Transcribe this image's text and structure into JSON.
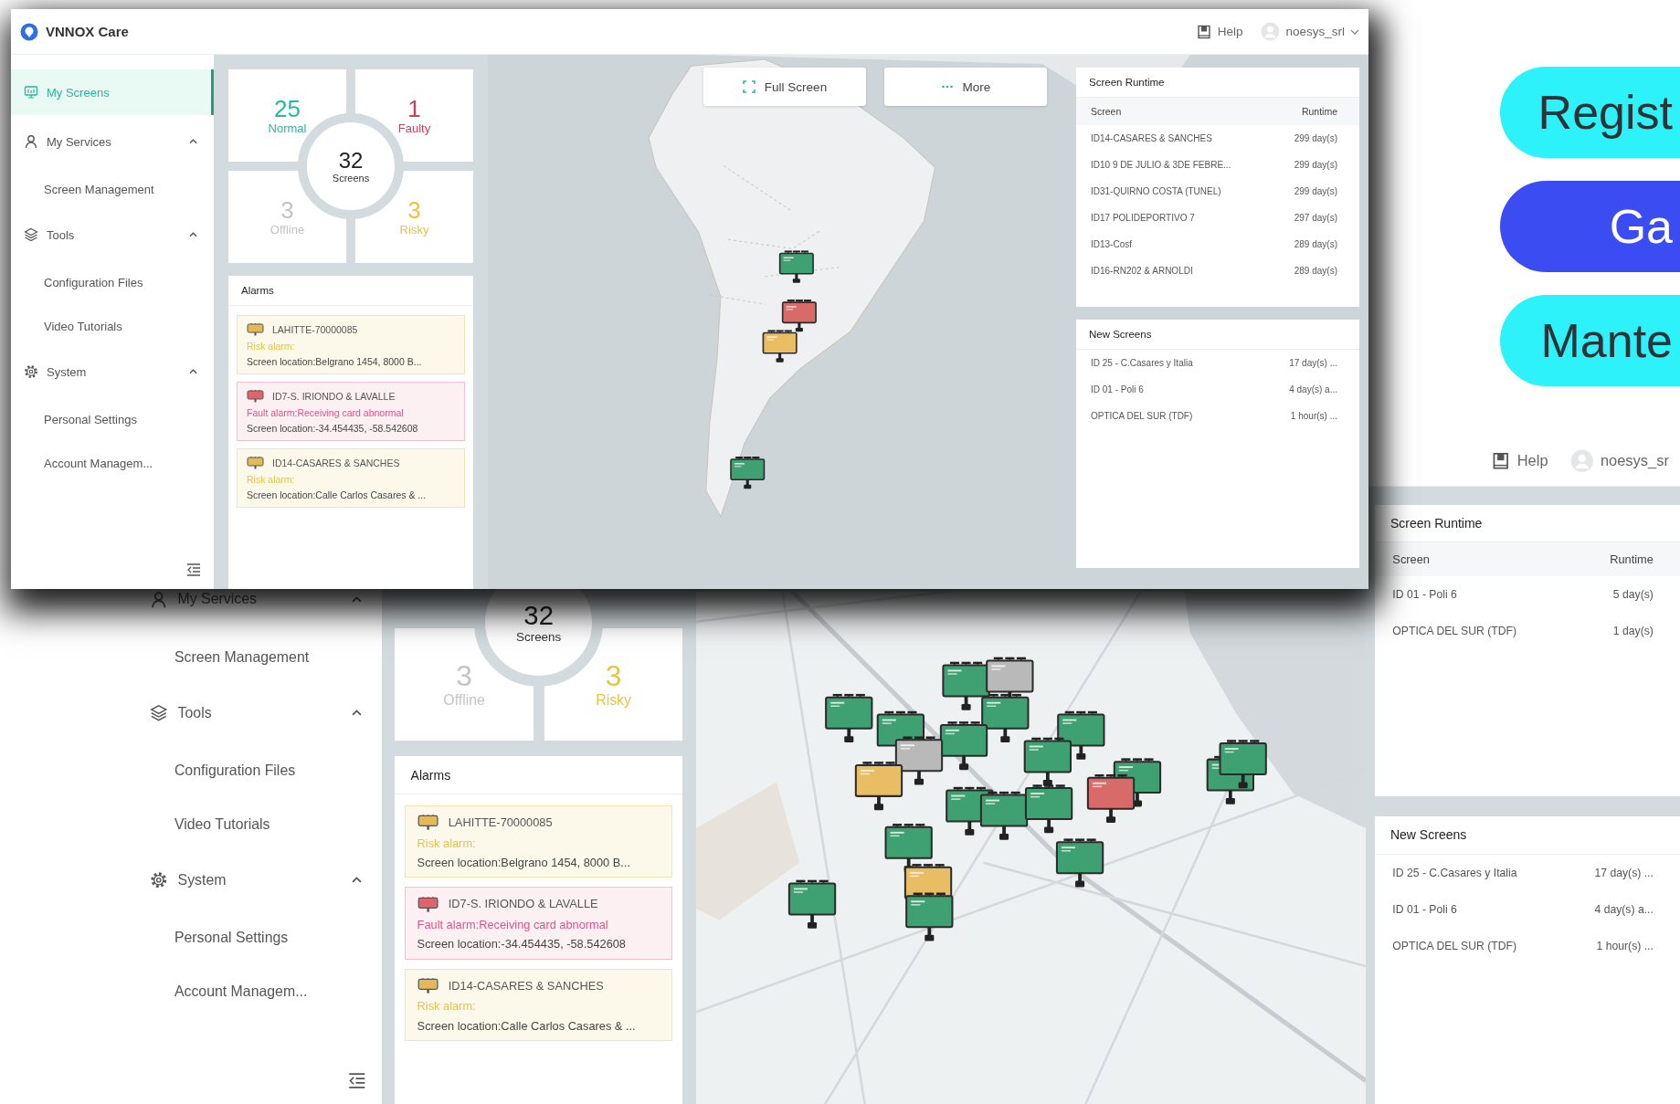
{
  "back_window": {
    "header": {
      "help": "Help",
      "user": "noesys_sr"
    },
    "sidebar": {
      "items": [
        {
          "label": "My Services",
          "kind": "services",
          "selected": false,
          "expanded": true,
          "children": [
            {
              "label": "Screen Management",
              "selected": false
            }
          ]
        },
        {
          "label": "Tools",
          "kind": "tools",
          "selected": false,
          "expanded": true,
          "children": [
            {
              "label": "Configuration Files",
              "selected": false
            },
            {
              "label": "Video Tutorials",
              "selected": false
            }
          ]
        },
        {
          "label": "System",
          "kind": "system",
          "selected": false,
          "expanded": true,
          "children": [
            {
              "label": "Personal Settings",
              "selected": false
            },
            {
              "label": "Account Managem...",
              "selected": false
            }
          ]
        }
      ]
    },
    "stats": {
      "total": "32",
      "total_label": "Screens",
      "tiles": [
        {
          "count": "3",
          "label": "Offline",
          "color": "#c4c4c4"
        },
        {
          "count": "3",
          "label": "Risky",
          "color": "#e8c440"
        }
      ]
    },
    "alarms": {
      "title": "Alarms",
      "items": [
        {
          "kind": "risk",
          "name": "LAHITTE-70000085",
          "message": "Risk alarm:",
          "location": "Screen location:Belgrano 1454, 8000 B..."
        },
        {
          "kind": "fault",
          "name": "ID7-S. IRIONDO & LAVALLE",
          "message": "Fault alarm:Receiving card abnormal",
          "location": "Screen location:-34.454435, -58.542608"
        },
        {
          "kind": "risk",
          "name": "ID14-CASARES & SANCHES",
          "message": "Risk alarm:",
          "location": "Screen location:Calle Carlos Casares & ..."
        }
      ]
    },
    "map": {
      "markers": [
        {
          "color": "#3fa071"
        },
        {
          "color": "#3fa071"
        },
        {
          "color": "#3fa071"
        },
        {
          "color": "#b9b9b9"
        },
        {
          "color": "#3fa071"
        },
        {
          "color": "#3fa071"
        },
        {
          "color": "#b9b9b9"
        },
        {
          "color": "#e9bd64"
        },
        {
          "color": "#3fa071"
        },
        {
          "color": "#3fa071"
        },
        {
          "color": "#3fa071"
        },
        {
          "color": "#d96a6a"
        },
        {
          "color": "#3fa071"
        },
        {
          "color": "#3fa071"
        },
        {
          "color": "#3fa071"
        },
        {
          "color": "#3fa071"
        },
        {
          "color": "#3fa071"
        },
        {
          "color": "#3fa071"
        },
        {
          "color": "#3fa071"
        },
        {
          "color": "#e9bd64"
        },
        {
          "color": "#3fa071"
        },
        {
          "color": "#3fa071"
        }
      ]
    },
    "runtime": {
      "title": "Screen Runtime",
      "columns": [
        "Screen",
        "Runtime"
      ],
      "rows": [
        [
          "ID 01 - Poli 6",
          "5 day(s)"
        ],
        [
          "OPTICA DEL SUR (TDF)",
          "1 day(s)"
        ]
      ]
    },
    "new_screens": {
      "title": "New Screens",
      "rows": [
        [
          "ID 25 - C.Casares y Italia",
          "17 day(s) ..."
        ],
        [
          "ID 01 - Poli 6",
          "4 day(s) a..."
        ],
        [
          "OPTICA DEL SUR (TDF)",
          "1 hour(s) ..."
        ]
      ]
    }
  },
  "front_window": {
    "header": {
      "app_name": "VNNOX Care",
      "help": "Help",
      "user": "noesys_srl"
    },
    "sidebar": {
      "items": [
        {
          "label": "My Screens",
          "kind": "screens",
          "selected": true
        },
        {
          "label": "My Services",
          "kind": "services",
          "selected": false,
          "expanded": true,
          "children": [
            {
              "label": "Screen Management",
              "selected": false
            }
          ]
        },
        {
          "label": "Tools",
          "kind": "tools",
          "selected": false,
          "expanded": true,
          "children": [
            {
              "label": "Configuration Files",
              "selected": false
            },
            {
              "label": "Video Tutorials",
              "selected": false
            }
          ]
        },
        {
          "label": "System",
          "kind": "system",
          "selected": false,
          "expanded": true,
          "children": [
            {
              "label": "Personal Settings",
              "selected": false
            },
            {
              "label": "Account Managem...",
              "selected": false
            }
          ]
        }
      ]
    },
    "stats": {
      "total": "32",
      "total_label": "Screens",
      "tiles": [
        {
          "count": "25",
          "label": "Normal",
          "color": "#2bb5a0"
        },
        {
          "count": "1",
          "label": "Faulty",
          "color": "#c8415a"
        },
        {
          "count": "3",
          "label": "Offline",
          "color": "#c4c4c4"
        },
        {
          "count": "3",
          "label": "Risky",
          "color": "#e8c440"
        }
      ]
    },
    "alarms": {
      "title": "Alarms",
      "items": [
        {
          "kind": "risk",
          "name": "LAHITTE-70000085",
          "message": "Risk alarm:",
          "location": "Screen location:Belgrano 1454, 8000 B..."
        },
        {
          "kind": "fault",
          "name": "ID7-S. IRIONDO & LAVALLE",
          "message": "Fault alarm:Receiving card abnormal",
          "location": "Screen location:-34.454435, -58.542608"
        },
        {
          "kind": "risk",
          "name": "ID14-CASARES & SANCHES",
          "message": "Risk alarm:",
          "location": "Screen location:Calle Carlos Casares & ..."
        }
      ]
    },
    "map_buttons": [
      {
        "kind": "fullscreen",
        "label": "Full Screen"
      },
      {
        "kind": "more",
        "label": "More"
      }
    ],
    "map": {
      "markers": [
        {
          "color": "#3fa071"
        },
        {
          "color": "#d96a6a"
        },
        {
          "color": "#e9bd64"
        },
        {
          "color": "#3fa071"
        }
      ]
    },
    "runtime": {
      "title": "Screen Runtime",
      "columns": [
        "Screen",
        "Runtime"
      ],
      "rows": [
        [
          "ID14-CASARES & SANCHES",
          "299 day(s)"
        ],
        [
          "ID10 9 DE JULIO & 3DE FEBRE...",
          "299 day(s)"
        ],
        [
          "ID31-QUIRNO COSTA (TUNEL)",
          "299 day(s)"
        ],
        [
          "ID17 POLIDEPORTIVO 7",
          "297 day(s)"
        ],
        [
          "ID13-Cosf",
          "289 day(s)"
        ],
        [
          "ID16-RN202 & ARNOLDI",
          "289 day(s)"
        ]
      ]
    },
    "new_screens": {
      "title": "New Screens",
      "rows": [
        [
          "ID 25 - C.Casares y Italia",
          "17 day(s) ..."
        ],
        [
          "ID 01 - Poli 6",
          "4 day(s) a..."
        ],
        [
          "OPTICA DEL SUR (TDF)",
          "1 hour(s) ..."
        ]
      ]
    }
  },
  "promo_tags": [
    {
      "label": "Regist",
      "color": "#2ef2f9"
    },
    {
      "label": "Ga",
      "color": "#3a4cf2"
    },
    {
      "label": "Mante",
      "color": "#2ef2f9"
    }
  ]
}
